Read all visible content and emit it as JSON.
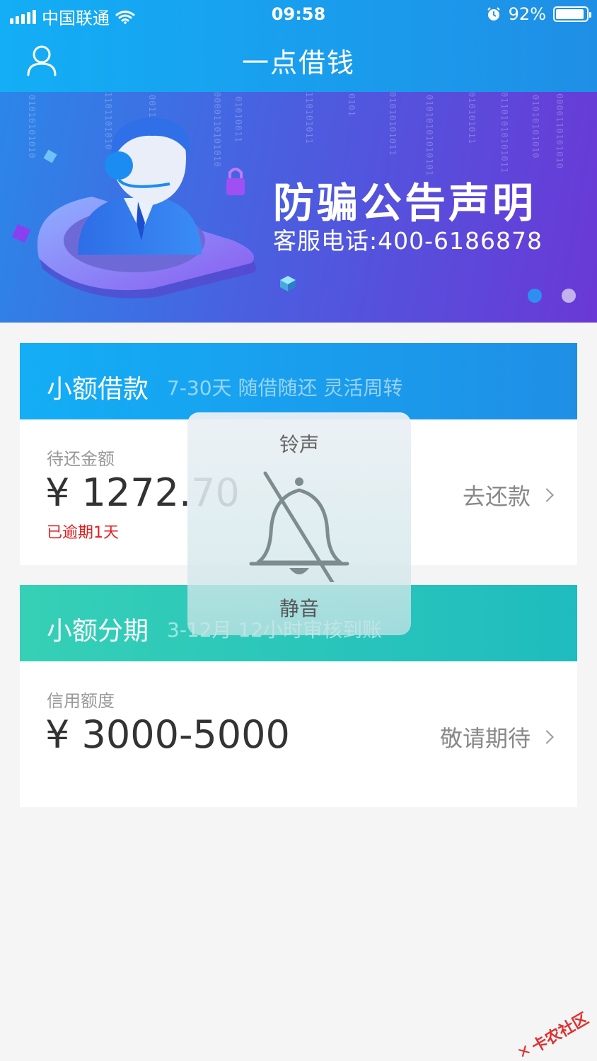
{
  "status_bar": {
    "carrier": "中国联通",
    "time": "09:58",
    "battery_pct": "92%",
    "battery_level": 0.92
  },
  "nav": {
    "title": "一点借钱",
    "user_icon": "user-icon"
  },
  "banner": {
    "title": "防骗公告声明",
    "subtitle": "客服电话:400-6186878",
    "active_dot": 0,
    "dot_count": 2
  },
  "cards": {
    "loan": {
      "name": "小额借款",
      "desc": "7-30天 随借随还 灵活周转",
      "label": "待还金额",
      "amount": "¥ 1272.70",
      "status": "已逾期1天",
      "action": "去还款",
      "color": "#19a3f0"
    },
    "installment": {
      "name": "小额分期",
      "desc": "3-12月 12小时审核到账",
      "label": "信用额度",
      "amount": "¥ 3000-5000",
      "action": "敬请期待",
      "color": "#2ec7b6"
    }
  },
  "ringer_hud": {
    "title": "铃声",
    "state": "静音",
    "icon": "bell-muted-icon"
  },
  "watermark": {
    "text": "卡农社区"
  }
}
